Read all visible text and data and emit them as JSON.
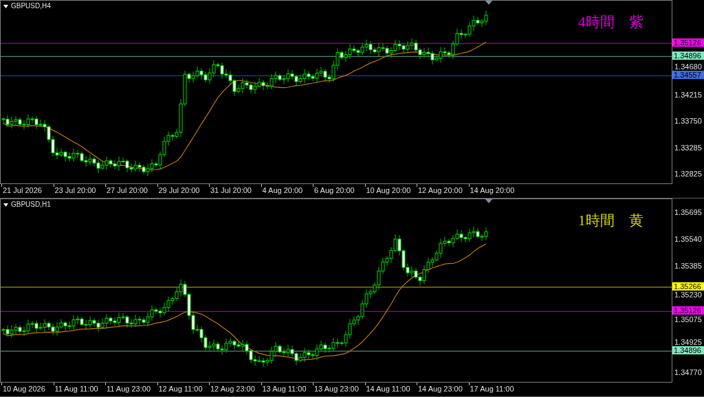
{
  "charts": [
    {
      "title": "GBPUSD,H4",
      "note": {
        "text": "4時間　紫",
        "color": "#e000e0"
      },
      "price_ticks": [
        "1.34680",
        "1.34215",
        "1.33750",
        "1.33285",
        "1.32825"
      ],
      "levels": [
        {
          "price": "1.35126",
          "color": "#ff00ff"
        },
        {
          "price": "1.34896",
          "color": "#7fe8c0"
        },
        {
          "price": "1.34557",
          "color": "#3c6ee0"
        }
      ],
      "time_labels": [
        "21 Jul 2026",
        "23 Jul 20:00",
        "27 Jul 20:00",
        "29 Jul 20:00",
        "31 Jul 20:00",
        "4 Aug 20:00",
        "6 Aug 20:00",
        "10 Aug 20:00",
        "12 Aug 20:00",
        "14 Aug 20:00"
      ]
    },
    {
      "title": "GBPUSD,H1",
      "note": {
        "text": "1時間　黄",
        "color": "#d8d800"
      },
      "price_ticks": [
        "1.35695",
        "1.35540",
        "1.35385",
        "1.35230",
        "1.35075",
        "1.34925",
        "1.34770"
      ],
      "levels": [
        {
          "price": "1.35266",
          "color": "#ffff00"
        },
        {
          "price": "1.35126",
          "color": "#ff00ff"
        },
        {
          "price": "1.34896",
          "color": "#7fe8c0"
        }
      ],
      "time_labels": [
        "10 Aug 2026",
        "11 Aug 11:00",
        "11 Aug 23:00",
        "12 Aug 11:00",
        "12 Aug 23:00",
        "13 Aug 11:00",
        "13 Aug 23:00",
        "14 Aug 11:00",
        "14 Aug 23:00",
        "17 Aug 11:00"
      ]
    }
  ]
}
